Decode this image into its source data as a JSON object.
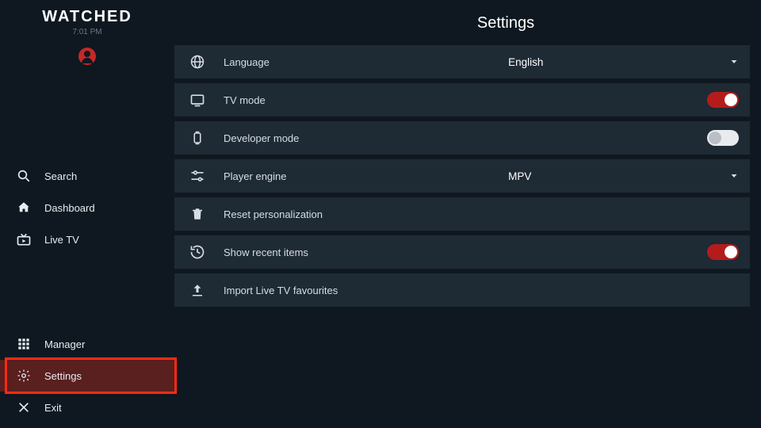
{
  "brand": {
    "name": "WATCHED",
    "time": "7:01 PM"
  },
  "sidebar": {
    "top": [
      {
        "label": "Search"
      },
      {
        "label": "Dashboard"
      },
      {
        "label": "Live TV"
      }
    ],
    "bottom": [
      {
        "label": "Manager"
      },
      {
        "label": "Settings"
      },
      {
        "label": "Exit"
      }
    ]
  },
  "page": {
    "title": "Settings"
  },
  "rows": {
    "language": {
      "label": "Language",
      "value": "English"
    },
    "tv_mode": {
      "label": "TV mode",
      "on": true
    },
    "dev_mode": {
      "label": "Developer mode",
      "on": false
    },
    "player": {
      "label": "Player engine",
      "value": "MPV"
    },
    "reset": {
      "label": "Reset personalization"
    },
    "recent": {
      "label": "Show recent items",
      "on": true
    },
    "import": {
      "label": "Import Live TV favourites"
    }
  }
}
